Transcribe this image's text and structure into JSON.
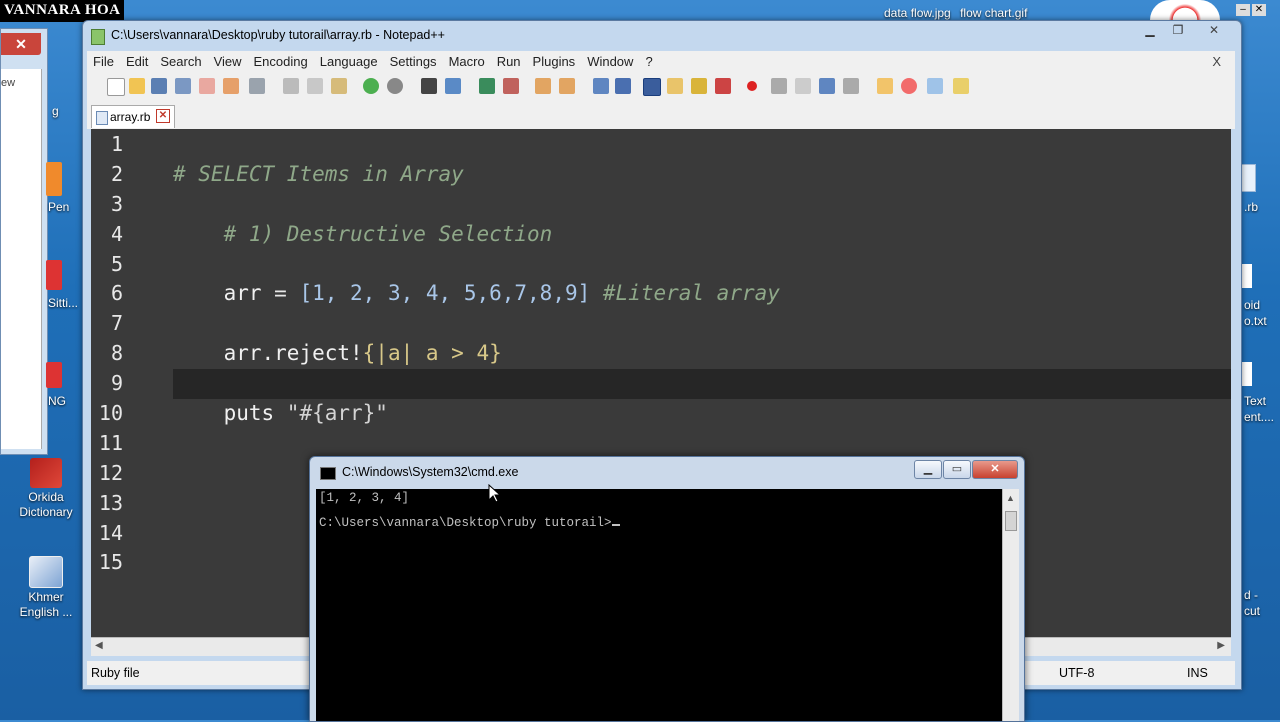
{
  "watermark": "VANNARA HOA",
  "desktop": {
    "top_files": [
      "data flow.jpg",
      "flow chart.gif"
    ],
    "left_icons": [
      {
        "label_line1": "Orkida",
        "label_line2": "Dictionary"
      },
      {
        "label_line1": "Khmer",
        "label_line2": "English ..."
      }
    ],
    "left_fragments": [
      "ew",
      "g",
      "Pen",
      "Sitti...",
      "NG"
    ],
    "right_fragments": [
      ".rb",
      "oid",
      "o.txt",
      "Text",
      "ent....",
      "d -",
      "cut"
    ]
  },
  "notepad": {
    "title": "C:\\Users\\vannara\\Desktop\\ruby tutorail\\array.rb - Notepad++",
    "menu": [
      "File",
      "Edit",
      "Search",
      "View",
      "Encoding",
      "Language",
      "Settings",
      "Macro",
      "Run",
      "Plugins",
      "Window",
      "?"
    ],
    "menu_close": "X",
    "tab_label": "array.rb",
    "line_numbers": [
      "1",
      "2",
      "3",
      "4",
      "5",
      "6",
      "7",
      "8",
      "9",
      "10",
      "11",
      "12",
      "13",
      "14",
      "15"
    ],
    "status": {
      "file_type": "Ruby file",
      "encoding": "UTF-8",
      "mode": "INS"
    }
  },
  "code": {
    "line2": "# SELECT Items in Array",
    "line4_indent": "    ",
    "line4": "# 1) Destructive Selection",
    "line6_var": "arr",
    "line6_eq": " = ",
    "line6_array": "[1, 2, 3, 4, 5,6,7,8,9]",
    "line6_comment": " #Literal array",
    "line8_a": "arr.reject!",
    "line8_b": "{|a| a > 4}",
    "line10_kw": "puts ",
    "line10_str": "\"#{arr}\""
  },
  "cmd": {
    "title": "C:\\Windows\\System32\\cmd.exe",
    "output_line1": "[1, 2, 3, 4]",
    "prompt": "C:\\Users\\vannara\\Desktop\\ruby tutorail>"
  },
  "colors": {
    "editor_bg": "#3a3a3a",
    "comment": "#8fa889",
    "bracket": "#d8c889",
    "desktop_bg": "#1f6fb8"
  },
  "icons": {
    "toolbar": [
      "new-file-icon",
      "open-file-icon",
      "save-icon",
      "save-all-icon",
      "close-icon",
      "close-all-icon",
      "print-icon",
      "cut-icon",
      "copy-icon",
      "paste-icon",
      "undo-icon",
      "redo-icon",
      "find-icon",
      "replace-icon",
      "zoom-in-icon",
      "zoom-out-icon",
      "sync-v-icon",
      "sync-h-icon",
      "word-wrap-icon",
      "show-all-chars-icon",
      "indent-guide-icon",
      "lang-icon",
      "doc-map-icon",
      "function-list-icon",
      "record-macro-icon",
      "stop-macro-icon",
      "play-macro-icon",
      "run-macro-multiple-icon",
      "save-macro-icon",
      "folder-workspace-icon",
      "heart-icon",
      "monitor-icon",
      "plugin-icon"
    ]
  }
}
